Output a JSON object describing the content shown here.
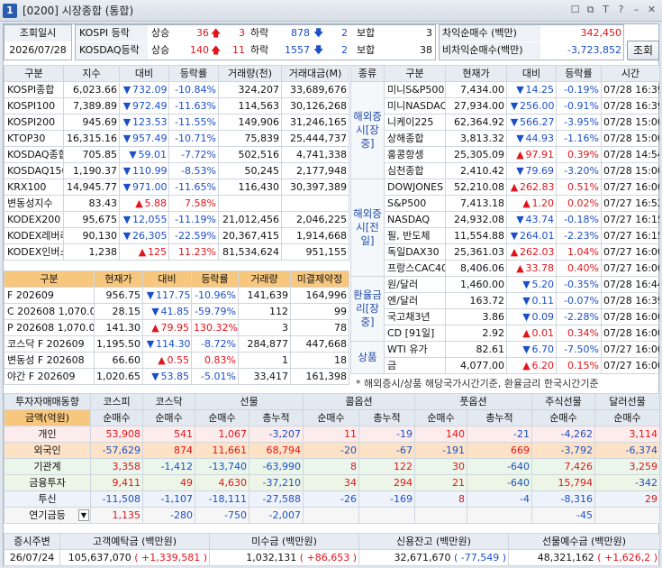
{
  "window": {
    "app_icon": "1",
    "title": "[0200] 시장종합 (통합)",
    "tools": [
      "☐",
      "⧉",
      "T",
      "?",
      "–",
      "✕"
    ]
  },
  "header": {
    "date_label": "조회일시",
    "date_value": "2026/07/28",
    "kospi_label": "KOSPI 등락",
    "kosdaq_label": "KOSDAQ등락",
    "up_label": "상승",
    "down_label": "하락",
    "flat_label": "보합",
    "kospi_up": "36",
    "kospi_up_limit": "3",
    "kospi_down": "878",
    "kospi_down_limit": "2",
    "kospi_flat": "3",
    "kosdaq_up": "140",
    "kosdaq_up_limit": "11",
    "kosdaq_down": "1557",
    "kosdaq_down_limit": "2",
    "kosdaq_flat": "38",
    "arb_label": "차익순매수 (백만)",
    "arb_value": "342,450",
    "nonarb_label": "비차익순매수(백만)",
    "nonarb_value": "-3,723,852",
    "inquiry_button": "조회"
  },
  "index_table": {
    "columns": [
      "구분",
      "지수",
      "대비",
      "등락률",
      "거래량(천)",
      "거래대금(M)"
    ],
    "rows": [
      {
        "name": "KOSPI종합",
        "value": "6,023.66",
        "dir": "▼",
        "change": "732.09",
        "rate": "-10.84%",
        "vol": "324,207",
        "amt": "33,689,676",
        "color": "blue"
      },
      {
        "name": "KOSPI100",
        "value": "7,389.89",
        "dir": "▼",
        "change": "972.49",
        "rate": "-11.63%",
        "vol": "114,563",
        "amt": "30,126,268",
        "color": "blue"
      },
      {
        "name": "KOSPI200",
        "value": "945.69",
        "dir": "▼",
        "change": "123.53",
        "rate": "-11.55%",
        "vol": "149,906",
        "amt": "31,246,165",
        "color": "blue"
      },
      {
        "name": "KTOP30",
        "value": "16,315.16",
        "dir": "▼",
        "change": "957.49",
        "rate": "-10.71%",
        "vol": "75,839",
        "amt": "25,444,737",
        "color": "blue"
      },
      {
        "name": "KOSDAQ종합",
        "value": "705.85",
        "dir": "▼",
        "change": "59.01",
        "rate": "-7.72%",
        "vol": "502,516",
        "amt": "4,741,338",
        "color": "blue"
      },
      {
        "name": "KOSDAQ150",
        "value": "1,190.37",
        "dir": "▼",
        "change": "110.99",
        "rate": "-8.53%",
        "vol": "50,245",
        "amt": "2,177,948",
        "color": "blue"
      },
      {
        "name": "KRX100",
        "value": "14,945.77",
        "dir": "▼",
        "change": "971.00",
        "rate": "-11.65%",
        "vol": "116,430",
        "amt": "30,397,389",
        "color": "blue"
      },
      {
        "name": "변동성지수",
        "value": "83.43",
        "dir": "▲",
        "change": "5.88",
        "rate": "7.58%",
        "vol": "",
        "amt": "",
        "color": "red"
      },
      {
        "name": "KODEX200",
        "value": "95,675",
        "dir": "▼",
        "change": "12,055",
        "rate": "-11.19%",
        "vol": "21,012,456",
        "amt": "2,046,225",
        "color": "blue"
      },
      {
        "name": "KODEX레버리",
        "value": "90,130",
        "dir": "▼",
        "change": "26,305",
        "rate": "-22.59%",
        "vol": "20,367,415",
        "amt": "1,914,668",
        "color": "blue"
      },
      {
        "name": "KODEX인버스",
        "value": "1,238",
        "dir": "▲",
        "change": "125",
        "rate": "11.23%",
        "vol": "81,534,624",
        "amt": "951,155",
        "color": "red"
      }
    ]
  },
  "futures_table": {
    "columns": [
      "구분",
      "현재가",
      "대비",
      "등락률",
      "거래량",
      "미결제약정"
    ],
    "rows": [
      {
        "name": "F 202609",
        "value": "956.75",
        "dir": "▼",
        "change": "117.75",
        "rate": "-10.96%",
        "vol": "141,639",
        "oi": "164,996",
        "color": "blue"
      },
      {
        "name": "C 202608 1,070.0",
        "value": "28.15",
        "dir": "▼",
        "change": "41.85",
        "rate": "-59.79%",
        "vol": "112",
        "oi": "99",
        "color": "blue"
      },
      {
        "name": "P 202608 1,070.0",
        "value": "141.30",
        "dir": "▲",
        "change": "79.95",
        "rate": "130.32%",
        "vol": "3",
        "oi": "78",
        "color": "red"
      },
      {
        "name": "코스닥 F 202609",
        "value": "1,195.50",
        "dir": "▼",
        "change": "114.30",
        "rate": "-8.72%",
        "vol": "284,877",
        "oi": "447,668",
        "color": "blue"
      },
      {
        "name": "변동성 F 202608",
        "value": "66.60",
        "dir": "▲",
        "change": "0.55",
        "rate": "0.83%",
        "vol": "1",
        "oi": "18",
        "color": "red"
      },
      {
        "name": "야간 F 202609",
        "value": "1,020.65",
        "dir": "▼",
        "change": "53.85",
        "rate": "-5.01%",
        "vol": "33,417",
        "oi": "161,398",
        "color": "blue"
      }
    ]
  },
  "world_table": {
    "columns": [
      "종류",
      "구분",
      "현재가",
      "대비",
      "등락률",
      "시간"
    ],
    "groups": [
      {
        "label": "해외증시[장중]",
        "rows": [
          {
            "name": "미니S&P500",
            "value": "7,434.00",
            "dir": "▼",
            "change": "14.25",
            "rate": "-0.19%",
            "time": "07/28 16:39",
            "color": "blue"
          },
          {
            "name": "미니NASDAQ",
            "value": "27,934.00",
            "dir": "▼",
            "change": "256.00",
            "rate": "-0.91%",
            "time": "07/28 16:39",
            "color": "blue"
          },
          {
            "name": "니케이225",
            "value": "62,364.92",
            "dir": "▼",
            "change": "566.27",
            "rate": "-3.95%",
            "time": "07/28 15:00",
            "color": "blue"
          },
          {
            "name": "상해종합",
            "value": "3,813.32",
            "dir": "▼",
            "change": "44.93",
            "rate": "-1.16%",
            "time": "07/28 15:00",
            "color": "blue"
          },
          {
            "name": "홍콩항셍",
            "value": "25,305.09",
            "dir": "▲",
            "change": "97.91",
            "rate": "0.39%",
            "time": "07/28 14:54",
            "color": "red"
          },
          {
            "name": "심천종합",
            "value": "2,410.42",
            "dir": "▼",
            "change": "79.69",
            "rate": "-3.20%",
            "time": "07/28 15:00",
            "color": "blue"
          }
        ]
      },
      {
        "label": "해외증시[전일]",
        "rows": [
          {
            "name": "DOWJONES",
            "value": "52,210.08",
            "dir": "▲",
            "change": "262.83",
            "rate": "0.51%",
            "time": "07/27 16:00",
            "color": "red"
          },
          {
            "name": "S&P500",
            "value": "7,413.18",
            "dir": "▲",
            "change": "1.20",
            "rate": "0.02%",
            "time": "07/27 16:52",
            "color": "red"
          },
          {
            "name": "NASDAQ",
            "value": "24,932.08",
            "dir": "▼",
            "change": "43.74",
            "rate": "-0.18%",
            "time": "07/27 16:15",
            "color": "blue"
          },
          {
            "name": "필, 반도체",
            "value": "11,554.88",
            "dir": "▼",
            "change": "264.01",
            "rate": "-2.23%",
            "time": "07/27 16:15",
            "color": "blue"
          },
          {
            "name": "독일DAX30",
            "value": "25,361.03",
            "dir": "▲",
            "change": "262.03",
            "rate": "1.04%",
            "time": "07/27 16:00",
            "color": "red"
          },
          {
            "name": "프랑스CAC40",
            "value": "8,406.06",
            "dir": "▲",
            "change": "33.78",
            "rate": "0.40%",
            "time": "07/27 16:00",
            "color": "red"
          }
        ]
      },
      {
        "label": "환율금리[장중]",
        "rows": [
          {
            "name": "원/달러",
            "value": "1,460.00",
            "dir": "▼",
            "change": "5.20",
            "rate": "-0.35%",
            "time": "07/28 16:44",
            "color": "blue"
          },
          {
            "name": "엔/달러",
            "value": "163.72",
            "dir": "▼",
            "change": "0.11",
            "rate": "-0.07%",
            "time": "07/28 16:39",
            "color": "blue"
          },
          {
            "name": "국고채3년",
            "value": "3.86",
            "dir": "▼",
            "change": "0.09",
            "rate": "-2.28%",
            "time": "07/28 16:00",
            "color": "blue"
          },
          {
            "name": "CD [91일]",
            "value": "2.92",
            "dir": "▲",
            "change": "0.01",
            "rate": "0.34%",
            "time": "07/28 16:00",
            "color": "red"
          }
        ]
      },
      {
        "label": "상품",
        "rows": [
          {
            "name": "WTI 유가",
            "value": "82.61",
            "dir": "▼",
            "change": "6.70",
            "rate": "-7.50%",
            "time": "07/27 16:00",
            "color": "blue"
          },
          {
            "name": "금",
            "value": "4,077.00",
            "dir": "▲",
            "change": "6.20",
            "rate": "0.15%",
            "time": "07/27 16:00",
            "color": "red"
          }
        ]
      }
    ],
    "note": "* 해외증시/상품 해당국가시간기준, 환율금리 한국시간기준"
  },
  "investor_table": {
    "title": "투자자매매동향",
    "amount_label": "금액(억원)",
    "head1": [
      "코스피",
      "코스닥",
      "선물",
      "콜옵션",
      "풋옵션",
      "주식선물",
      "달러선물"
    ],
    "head2": [
      "순매수",
      "순매수",
      "순매수",
      "총누적",
      "순매수",
      "총누적",
      "순매수",
      "총누적",
      "순매수",
      "순매수"
    ],
    "rows": [
      {
        "name": "개인",
        "cls": "i-ind",
        "vals": [
          "53,908",
          "541",
          "1,067",
          "-3,207",
          "11",
          "-19",
          "140",
          "-21",
          "-4,262",
          "3,114"
        ]
      },
      {
        "name": "외국인",
        "cls": "i-frg",
        "vals": [
          "-57,629",
          "874",
          "11,661",
          "68,794",
          "-20",
          "-67",
          "-191",
          "669",
          "-3,792",
          "-6,374"
        ]
      },
      {
        "name": "기관계",
        "cls": "i-inst",
        "vals": [
          "3,358",
          "-1,412",
          "-13,740",
          "-63,990",
          "8",
          "122",
          "30",
          "-640",
          "7,426",
          "3,259"
        ]
      },
      {
        "name": "금융투자",
        "cls": "i-fin",
        "vals": [
          "9,411",
          "49",
          "4,630",
          "-37,210",
          "34",
          "294",
          "21",
          "-640",
          "15,794",
          "-342"
        ]
      },
      {
        "name": "투신",
        "cls": "i-trust",
        "vals": [
          "-11,508",
          "-1,107",
          "-18,111",
          "-27,588",
          "-26",
          "-169",
          "8",
          "-4",
          "-8,316",
          "29"
        ]
      },
      {
        "name": "연기금등",
        "cls": "i-pens",
        "vals": [
          "1,135",
          "-280",
          "-750",
          "-2,007",
          "",
          "",
          "",
          "",
          "-45",
          ""
        ]
      }
    ]
  },
  "bottom_table": {
    "headers": [
      "증시주변",
      "고객예탁금 (백만원)",
      "미수금 (백만원)",
      "신용잔고 (백만원)",
      "선물예수금 (백만원)"
    ],
    "date": "26/07/24",
    "deposit": "105,637,070",
    "deposit_chg": "( +1,339,581 )",
    "unpaid": "1,032,131",
    "unpaid_chg": "( +86,653 )",
    "credit": "32,671,670",
    "credit_chg": "( -77,549 )",
    "fut_dep": "48,321,162",
    "fut_dep_chg": "( +1,626,2 )"
  },
  "colors": {
    "up": "#e0141b",
    "down": "#1b4fc8",
    "header_orange": "#f7c77d"
  }
}
